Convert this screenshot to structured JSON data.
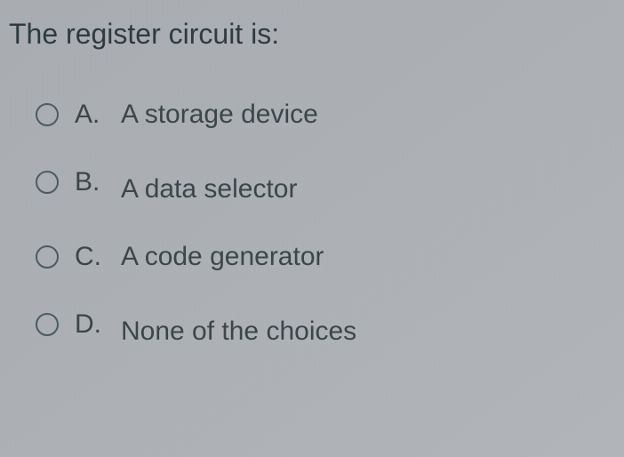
{
  "question": "The register circuit is:",
  "options": [
    {
      "letter": "A.",
      "text": "A storage device"
    },
    {
      "letter": "B.",
      "text": "A data selector"
    },
    {
      "letter": "C.",
      "text": "A code generator"
    },
    {
      "letter": "D.",
      "text": "None of the choices"
    }
  ]
}
